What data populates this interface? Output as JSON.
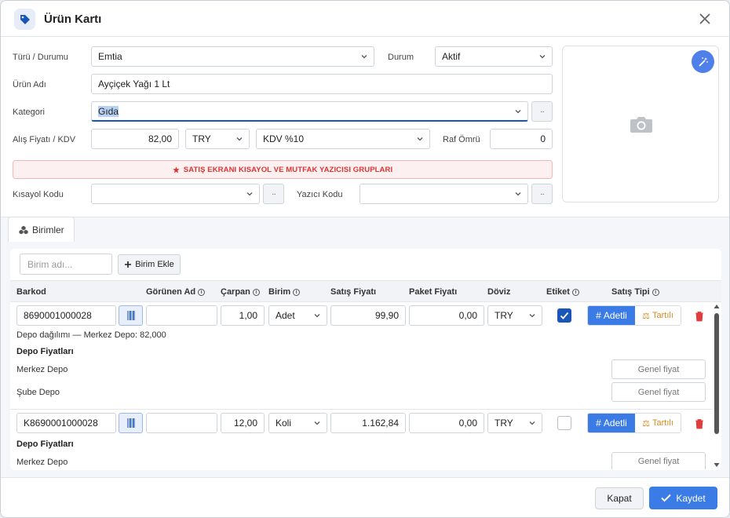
{
  "header": {
    "title": "Ürün Kartı"
  },
  "form": {
    "type_label": "Türü / Durumu",
    "type_value": "Emtia",
    "status_label": "Durum",
    "status_value": "Aktif",
    "name_label": "Ürün Adı",
    "name_value": "Ayçiçek Yağı 1 Lt",
    "category_label": "Kategori",
    "category_value": "Gıda",
    "price_label": "Alış Fiyatı / KDV",
    "price_value": "82,00",
    "currency_value": "TRY",
    "vat_value": "KDV %10",
    "shelf_label": "Raf Ömrü",
    "shelf_value": "0",
    "banner": "SATIŞ EKRANI KISAYOL VE MUTFAK YAZICISI GRUPLARI",
    "shortcut_label": "Kısayol Kodu",
    "printer_label": "Yazıcı Kodu",
    "dots": "··"
  },
  "tabs": {
    "units": "Birimler"
  },
  "units": {
    "search_placeholder": "Birim adı...",
    "add_label": "Birim Ekle",
    "columns": {
      "barcode": "Barkod",
      "display_name": "Görünen Ad",
      "multiplier": "Çarpan",
      "unit": "Birim",
      "sale_price": "Satış Fiyatı",
      "package_price": "Paket Fiyatı",
      "currency": "Döviz",
      "label": "Etiket",
      "sale_type": "Satış Tipi"
    },
    "rows": [
      {
        "barcode": "8690001000028",
        "display_name": "",
        "multiplier": "1,00",
        "unit": "Adet",
        "sale_price": "99,90",
        "package_price": "0,00",
        "currency": "TRY",
        "label_checked": true,
        "type_a": "Adetli",
        "type_b": "Tartılı",
        "depot_info": "Depo dağılımı — Merkez Depo: 82,000",
        "depot_prices_title": "Depo Fiyatları",
        "depots": [
          {
            "name": "Merkez Depo",
            "price_placeholder": "Genel fiyat"
          },
          {
            "name": "Şube Depo",
            "price_placeholder": "Genel fiyat"
          }
        ]
      },
      {
        "barcode": "K8690001000028",
        "display_name": "",
        "multiplier": "12,00",
        "unit": "Koli",
        "sale_price": "1.162,84",
        "package_price": "0,00",
        "currency": "TRY",
        "label_checked": false,
        "type_a": "Adetli",
        "type_b": "Tartılı",
        "depot_prices_title": "Depo Fiyatları",
        "depots": [
          {
            "name": "Merkez Depo",
            "price_placeholder": "Genel fiyat"
          }
        ]
      }
    ]
  },
  "footer": {
    "close_label": "Kapat",
    "save_label": "Kaydet"
  },
  "colors": {
    "accent": "#3b7be6",
    "danger": "#d33",
    "weight": "#d78a1e"
  }
}
